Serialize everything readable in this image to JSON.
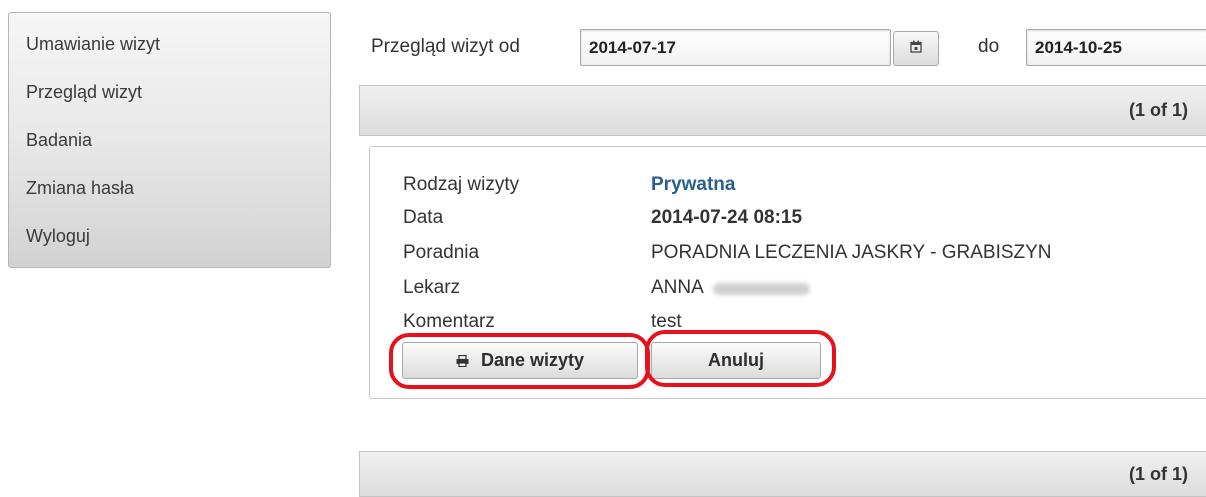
{
  "sidebar": {
    "items": [
      {
        "label": "Umawianie wizyt"
      },
      {
        "label": "Przegląd wizyt"
      },
      {
        "label": "Badania"
      },
      {
        "label": "Zmiana hasła"
      },
      {
        "label": "Wyloguj"
      }
    ]
  },
  "filter": {
    "from_label": "Przegląd wizyt od",
    "from_value": "2014-07-17",
    "to_label": "do",
    "to_value": "2014-10-25",
    "calendar_icon": "calendar-icon"
  },
  "paginator": {
    "top": "(1 of 1)",
    "bottom": "(1 of 1)"
  },
  "visit": {
    "fields": [
      {
        "label": "Rodzaj wizyty",
        "value": "Prywatna"
      },
      {
        "label": "Data",
        "value": "2014-07-24 08:15"
      },
      {
        "label": "Poradnia",
        "value": "PORADNIA LECZENIA JASKRY - GRABISZYN"
      },
      {
        "label": "Lekarz",
        "value": "ANNA"
      },
      {
        "label": "Komentarz",
        "value": "test"
      }
    ],
    "details_button": "Dane wizyty",
    "details_icon": "print-icon",
    "cancel_button": "Anuluj"
  },
  "colors": {
    "highlight": "#e8101a",
    "visit_type": "#2b5f8e"
  }
}
